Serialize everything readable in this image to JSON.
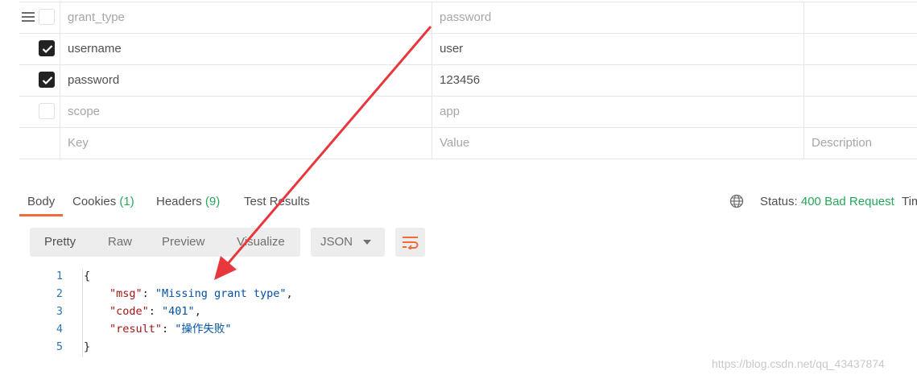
{
  "params": {
    "rows": [
      {
        "checked": false,
        "key": "grant_type",
        "value": "password",
        "key_muted": true,
        "value_muted": true,
        "desc": ""
      },
      {
        "checked": true,
        "key": "username",
        "value": "user",
        "key_muted": false,
        "value_muted": false,
        "desc": ""
      },
      {
        "checked": true,
        "key": "password",
        "value": "123456",
        "key_muted": false,
        "value_muted": false,
        "desc": ""
      },
      {
        "checked": false,
        "key": "scope",
        "value": "app",
        "key_muted": true,
        "value_muted": true,
        "desc": ""
      }
    ],
    "placeholder": {
      "key": "Key",
      "value": "Value",
      "desc": "Description"
    }
  },
  "response_tabs": {
    "body": "Body",
    "cookies": "Cookies",
    "cookies_count": "(1)",
    "headers": "Headers",
    "headers_count": "(9)",
    "tests": "Test Results"
  },
  "status": {
    "label": "Status:",
    "value": "400 Bad Request",
    "time_label": "Tim",
    "status_color": "#26a65b"
  },
  "view_options": {
    "pretty": "Pretty",
    "raw": "Raw",
    "preview": "Preview",
    "visualize": "Visualize",
    "format": "JSON"
  },
  "code": {
    "line_numbers": [
      "1",
      "2",
      "3",
      "4",
      "5"
    ],
    "open_brace": "{",
    "close_brace": "}",
    "lines": [
      {
        "key": "\"msg\"",
        "value": "\"Missing grant type\"",
        "trail": ","
      },
      {
        "key": "\"code\"",
        "value": "\"401\"",
        "trail": ","
      },
      {
        "key": "\"result\"",
        "value": "\"操作失败\"",
        "trail": ""
      }
    ]
  },
  "watermark": "https://blog.csdn.net/qq_43437874",
  "colors": {
    "accent": "#f26b3a",
    "count": "#26a65b",
    "arrow": "#e8383d"
  },
  "icons": [
    "drag-handle-icon",
    "checkbox-checked-icon",
    "globe-icon",
    "caret-down-icon",
    "wrap-lines-icon"
  ]
}
